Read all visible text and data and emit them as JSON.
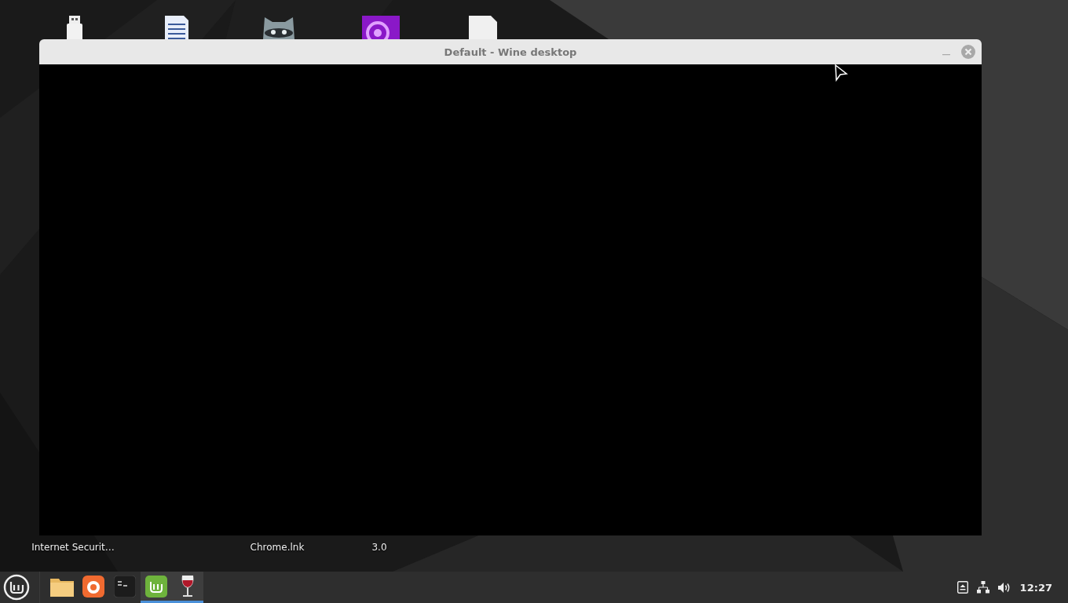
{
  "desktop": {
    "top_icons": [
      {
        "kind": "usb"
      },
      {
        "kind": "document"
      },
      {
        "kind": "raccoon"
      },
      {
        "kind": "media"
      },
      {
        "kind": "file"
      }
    ],
    "bottom_labels": [
      "Internet Securit…",
      "Chrome.lnk",
      "3.0"
    ]
  },
  "window": {
    "title": "Default - Wine desktop"
  },
  "taskbar": {
    "launchers": [
      {
        "kind": "folder",
        "active": false
      },
      {
        "kind": "firefox",
        "active": false
      },
      {
        "kind": "terminal",
        "active": false
      },
      {
        "kind": "mint",
        "active": true
      },
      {
        "kind": "wine",
        "active": true
      }
    ],
    "clock": "12:27"
  }
}
